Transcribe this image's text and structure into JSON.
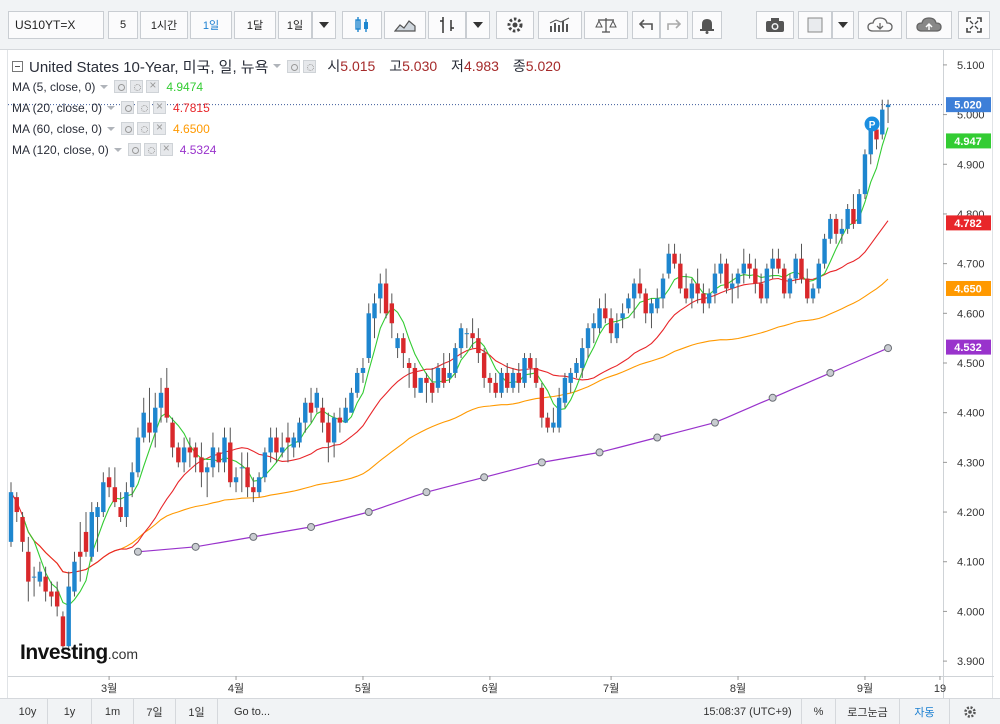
{
  "toolbar": {
    "symbol": "US10YT=X",
    "interval_value": "5",
    "interval_buttons": [
      "1시간",
      "1일",
      "1달",
      "1일"
    ],
    "active_interval_index": 1
  },
  "legend": {
    "title": "United States 10-Year, 미국, 일, 뉴욕",
    "ohlc": [
      {
        "label": "시",
        "value": "5.015"
      },
      {
        "label": "고",
        "value": "5.030"
      },
      {
        "label": "저",
        "value": "4.983"
      },
      {
        "label": "종",
        "value": "5.020"
      }
    ]
  },
  "moving_averages": [
    {
      "label": "MA (5, close, 0)",
      "value": "4.9474",
      "color": "#33cc33",
      "badge": "4.947"
    },
    {
      "label": "MA (20, close, 0)",
      "value": "4.7815",
      "color": "#e8262a",
      "badge": "4.782"
    },
    {
      "label": "MA (60, close, 0)",
      "value": "4.6500",
      "color": "#ff9900",
      "badge": "4.650"
    },
    {
      "label": "MA (120, close, 0)",
      "value": "4.5324",
      "color": "#9933cc",
      "badge": "4.532"
    }
  ],
  "colors": {
    "up": "#1e86cf",
    "down": "#d9282b",
    "accent": "#1b7fd1",
    "last_price_badge": "#3d7fd8"
  },
  "logo": {
    "brand": "Investing",
    "suffix": ".com"
  },
  "marker_label": "P",
  "bottombar": {
    "ranges": [
      "10y",
      "1y",
      "1m",
      "7일",
      "1일"
    ],
    "goto": "Go to...",
    "time": "15:08:37 (UTC+9)",
    "percent": "%",
    "log": "로그눈금",
    "auto": "자동"
  },
  "chart_data": {
    "type": "candlestick",
    "title": "",
    "xlabel": "",
    "ylabel": "",
    "ylim": [
      3.87,
      5.13
    ],
    "y_ticks": [
      3.9,
      4.0,
      4.1,
      4.2,
      4.3,
      4.4,
      4.5,
      4.6,
      4.7,
      4.8,
      4.9,
      5.0,
      5.1
    ],
    "x_ticks": [
      {
        "label": "3월",
        "index": 17
      },
      {
        "label": "4월",
        "index": 39
      },
      {
        "label": "5월",
        "index": 61
      },
      {
        "label": "6월",
        "index": 83
      },
      {
        "label": "7월",
        "index": 104
      },
      {
        "label": "8월",
        "index": 126
      },
      {
        "label": "9월",
        "index": 148
      },
      {
        "label": "19",
        "index": 161
      }
    ],
    "last_price": 5.02,
    "ohlc": [
      [
        4.14,
        4.26,
        4.13,
        4.24
      ],
      [
        4.23,
        4.24,
        4.18,
        4.2
      ],
      [
        4.19,
        4.2,
        4.12,
        4.14
      ],
      [
        4.12,
        4.15,
        4.02,
        4.06
      ],
      [
        4.07,
        4.09,
        4.03,
        4.07
      ],
      [
        4.06,
        4.1,
        4.05,
        4.08
      ],
      [
        4.07,
        4.09,
        4.02,
        4.04
      ],
      [
        4.04,
        4.06,
        4.01,
        4.03
      ],
      [
        4.04,
        4.06,
        3.99,
        4.01
      ],
      [
        3.99,
        4.0,
        3.92,
        3.93
      ],
      [
        3.93,
        4.08,
        3.92,
        4.05
      ],
      [
        4.04,
        4.12,
        4.03,
        4.1
      ],
      [
        4.12,
        4.18,
        4.06,
        4.11
      ],
      [
        4.16,
        4.2,
        4.11,
        4.12
      ],
      [
        4.11,
        4.22,
        4.1,
        4.2
      ],
      [
        4.19,
        4.22,
        4.12,
        4.21
      ],
      [
        4.2,
        4.28,
        4.19,
        4.26
      ],
      [
        4.27,
        4.29,
        4.23,
        4.25
      ],
      [
        4.25,
        4.29,
        4.21,
        4.22
      ],
      [
        4.21,
        4.24,
        4.18,
        4.19
      ],
      [
        4.19,
        4.26,
        4.17,
        4.24
      ],
      [
        4.25,
        4.3,
        4.23,
        4.28
      ],
      [
        4.28,
        4.37,
        4.27,
        4.35
      ],
      [
        4.35,
        4.43,
        4.34,
        4.4
      ],
      [
        4.38,
        4.45,
        4.34,
        4.36
      ],
      [
        4.36,
        4.44,
        4.33,
        4.41
      ],
      [
        4.41,
        4.47,
        4.38,
        4.44
      ],
      [
        4.45,
        4.49,
        4.38,
        4.39
      ],
      [
        4.38,
        4.39,
        4.31,
        4.33
      ],
      [
        4.33,
        4.34,
        4.29,
        4.3
      ],
      [
        4.3,
        4.35,
        4.28,
        4.33
      ],
      [
        4.33,
        4.35,
        4.29,
        4.32
      ],
      [
        4.33,
        4.34,
        4.28,
        4.31
      ],
      [
        4.31,
        4.34,
        4.25,
        4.28
      ],
      [
        4.28,
        4.3,
        4.23,
        4.29
      ],
      [
        4.29,
        4.36,
        4.27,
        4.33
      ],
      [
        4.32,
        4.33,
        4.28,
        4.3
      ],
      [
        4.3,
        4.37,
        4.28,
        4.35
      ],
      [
        4.34,
        4.37,
        4.25,
        4.26
      ],
      [
        4.26,
        4.29,
        4.24,
        4.27
      ],
      [
        4.29,
        4.32,
        4.24,
        4.29
      ],
      [
        4.29,
        4.32,
        4.23,
        4.25
      ],
      [
        4.25,
        4.27,
        4.22,
        4.24
      ],
      [
        4.24,
        4.28,
        4.23,
        4.27
      ],
      [
        4.27,
        4.33,
        4.26,
        4.32
      ],
      [
        4.32,
        4.37,
        4.3,
        4.35
      ],
      [
        4.35,
        4.37,
        4.3,
        4.32
      ],
      [
        4.32,
        4.36,
        4.31,
        4.33
      ],
      [
        4.35,
        4.38,
        4.3,
        4.34
      ],
      [
        4.33,
        4.36,
        4.31,
        4.35
      ],
      [
        4.34,
        4.39,
        4.33,
        4.38
      ],
      [
        4.38,
        4.43,
        4.36,
        4.42
      ],
      [
        4.42,
        4.45,
        4.38,
        4.4
      ],
      [
        4.41,
        4.45,
        4.4,
        4.44
      ],
      [
        4.41,
        4.43,
        4.36,
        4.38
      ],
      [
        4.38,
        4.4,
        4.3,
        4.34
      ],
      [
        4.34,
        4.4,
        4.31,
        4.39
      ],
      [
        4.39,
        4.41,
        4.36,
        4.38
      ],
      [
        4.38,
        4.43,
        4.38,
        4.41
      ],
      [
        4.4,
        4.45,
        4.4,
        4.44
      ],
      [
        4.44,
        4.49,
        4.43,
        4.48
      ],
      [
        4.48,
        4.51,
        4.46,
        4.49
      ],
      [
        4.51,
        4.62,
        4.5,
        4.6
      ],
      [
        4.59,
        4.64,
        4.55,
        4.62
      ],
      [
        4.63,
        4.68,
        4.6,
        4.66
      ],
      [
        4.66,
        4.69,
        4.59,
        4.6
      ],
      [
        4.62,
        4.64,
        4.55,
        4.58
      ],
      [
        4.53,
        4.56,
        4.51,
        4.55
      ],
      [
        4.55,
        4.56,
        4.49,
        4.52
      ],
      [
        4.5,
        4.51,
        4.45,
        4.49
      ],
      [
        4.49,
        4.5,
        4.43,
        4.45
      ],
      [
        4.44,
        4.47,
        4.44,
        4.47
      ],
      [
        4.47,
        4.48,
        4.42,
        4.46
      ],
      [
        4.46,
        4.49,
        4.42,
        4.44
      ],
      [
        4.45,
        4.5,
        4.44,
        4.49
      ],
      [
        4.49,
        4.52,
        4.45,
        4.46
      ],
      [
        4.47,
        4.52,
        4.46,
        4.48
      ],
      [
        4.48,
        4.54,
        4.47,
        4.53
      ],
      [
        4.53,
        4.58,
        4.51,
        4.57
      ],
      [
        4.56,
        4.57,
        4.53,
        4.56
      ],
      [
        4.56,
        4.59,
        4.53,
        4.55
      ],
      [
        4.55,
        4.57,
        4.5,
        4.52
      ],
      [
        4.52,
        4.53,
        4.45,
        4.47
      ],
      [
        4.47,
        4.48,
        4.44,
        4.46
      ],
      [
        4.46,
        4.48,
        4.43,
        4.44
      ],
      [
        4.44,
        4.49,
        4.43,
        4.48
      ],
      [
        4.48,
        4.5,
        4.44,
        4.45
      ],
      [
        4.45,
        4.49,
        4.44,
        4.48
      ],
      [
        4.48,
        4.5,
        4.44,
        4.46
      ],
      [
        4.46,
        4.52,
        4.45,
        4.51
      ],
      [
        4.51,
        4.52,
        4.47,
        4.49
      ],
      [
        4.49,
        4.51,
        4.45,
        4.46
      ],
      [
        4.45,
        4.46,
        4.37,
        4.39
      ],
      [
        4.39,
        4.4,
        4.36,
        4.37
      ],
      [
        4.37,
        4.41,
        4.36,
        4.38
      ],
      [
        4.37,
        4.45,
        4.36,
        4.43
      ],
      [
        4.42,
        4.48,
        4.41,
        4.47
      ],
      [
        4.46,
        4.49,
        4.44,
        4.48
      ],
      [
        4.48,
        4.51,
        4.47,
        4.5
      ],
      [
        4.49,
        4.55,
        4.47,
        4.53
      ],
      [
        4.53,
        4.58,
        4.51,
        4.57
      ],
      [
        4.57,
        4.6,
        4.54,
        4.58
      ],
      [
        4.57,
        4.63,
        4.56,
        4.61
      ],
      [
        4.61,
        4.64,
        4.58,
        4.59
      ],
      [
        4.59,
        4.61,
        4.54,
        4.56
      ],
      [
        4.55,
        4.6,
        4.54,
        4.58
      ],
      [
        4.59,
        4.62,
        4.57,
        4.6
      ],
      [
        4.61,
        4.64,
        4.6,
        4.63
      ],
      [
        4.63,
        4.67,
        4.59,
        4.66
      ],
      [
        4.66,
        4.69,
        4.63,
        4.64
      ],
      [
        4.64,
        4.65,
        4.58,
        4.6
      ],
      [
        4.6,
        4.63,
        4.57,
        4.62
      ],
      [
        4.61,
        4.65,
        4.6,
        4.63
      ],
      [
        4.63,
        4.68,
        4.61,
        4.67
      ],
      [
        4.68,
        4.74,
        4.67,
        4.72
      ],
      [
        4.72,
        4.74,
        4.69,
        4.7
      ],
      [
        4.7,
        4.72,
        4.64,
        4.65
      ],
      [
        4.65,
        4.68,
        4.62,
        4.63
      ],
      [
        4.63,
        4.67,
        4.61,
        4.66
      ],
      [
        4.66,
        4.69,
        4.62,
        4.64
      ],
      [
        4.64,
        4.66,
        4.6,
        4.62
      ],
      [
        4.62,
        4.65,
        4.61,
        4.64
      ],
      [
        4.64,
        4.7,
        4.62,
        4.68
      ],
      [
        4.68,
        4.72,
        4.66,
        4.7
      ],
      [
        4.7,
        4.71,
        4.64,
        4.65
      ],
      [
        4.65,
        4.68,
        4.62,
        4.66
      ],
      [
        4.66,
        4.69,
        4.63,
        4.68
      ],
      [
        4.68,
        4.73,
        4.66,
        4.7
      ],
      [
        4.7,
        4.72,
        4.67,
        4.69
      ],
      [
        4.69,
        4.71,
        4.64,
        4.66
      ],
      [
        4.66,
        4.68,
        4.62,
        4.63
      ],
      [
        4.63,
        4.7,
        4.62,
        4.69
      ],
      [
        4.69,
        4.73,
        4.67,
        4.71
      ],
      [
        4.71,
        4.73,
        4.68,
        4.69
      ],
      [
        4.69,
        4.7,
        4.63,
        4.64
      ],
      [
        4.64,
        4.68,
        4.63,
        4.67
      ],
      [
        4.67,
        4.72,
        4.66,
        4.71
      ],
      [
        4.71,
        4.74,
        4.66,
        4.67
      ],
      [
        4.67,
        4.69,
        4.62,
        4.63
      ],
      [
        4.63,
        4.66,
        4.62,
        4.65
      ],
      [
        4.65,
        4.71,
        4.64,
        4.7
      ],
      [
        4.7,
        4.76,
        4.69,
        4.75
      ],
      [
        4.75,
        4.8,
        4.74,
        4.79
      ],
      [
        4.79,
        4.8,
        4.74,
        4.76
      ],
      [
        4.76,
        4.79,
        4.74,
        4.77
      ],
      [
        4.77,
        4.82,
        4.76,
        4.81
      ],
      [
        4.81,
        4.84,
        4.77,
        4.78
      ],
      [
        4.78,
        4.85,
        4.78,
        4.84
      ],
      [
        4.84,
        4.93,
        4.83,
        4.92
      ],
      [
        4.92,
        4.98,
        4.9,
        4.97
      ],
      [
        4.97,
        4.99,
        4.93,
        4.95
      ],
      [
        4.96,
        5.03,
        4.95,
        5.01
      ],
      [
        5.015,
        5.03,
        4.983,
        5.02
      ]
    ],
    "ma_series": [
      {
        "name": "MA (5, close, 0)",
        "period": 5,
        "value": 4.9474
      },
      {
        "name": "MA (20, close, 0)",
        "period": 20,
        "value": 4.7815
      },
      {
        "name": "MA (60, close, 0)",
        "period": 60,
        "value": 4.65
      },
      {
        "name": "MA (120, close, 0)",
        "period": 120,
        "value": 4.5324
      }
    ],
    "ma120_points": [
      4.12,
      4.13,
      4.15,
      4.17,
      4.2,
      4.24,
      4.27,
      4.3,
      4.32,
      4.35,
      4.38,
      4.43,
      4.48,
      4.53
    ]
  }
}
